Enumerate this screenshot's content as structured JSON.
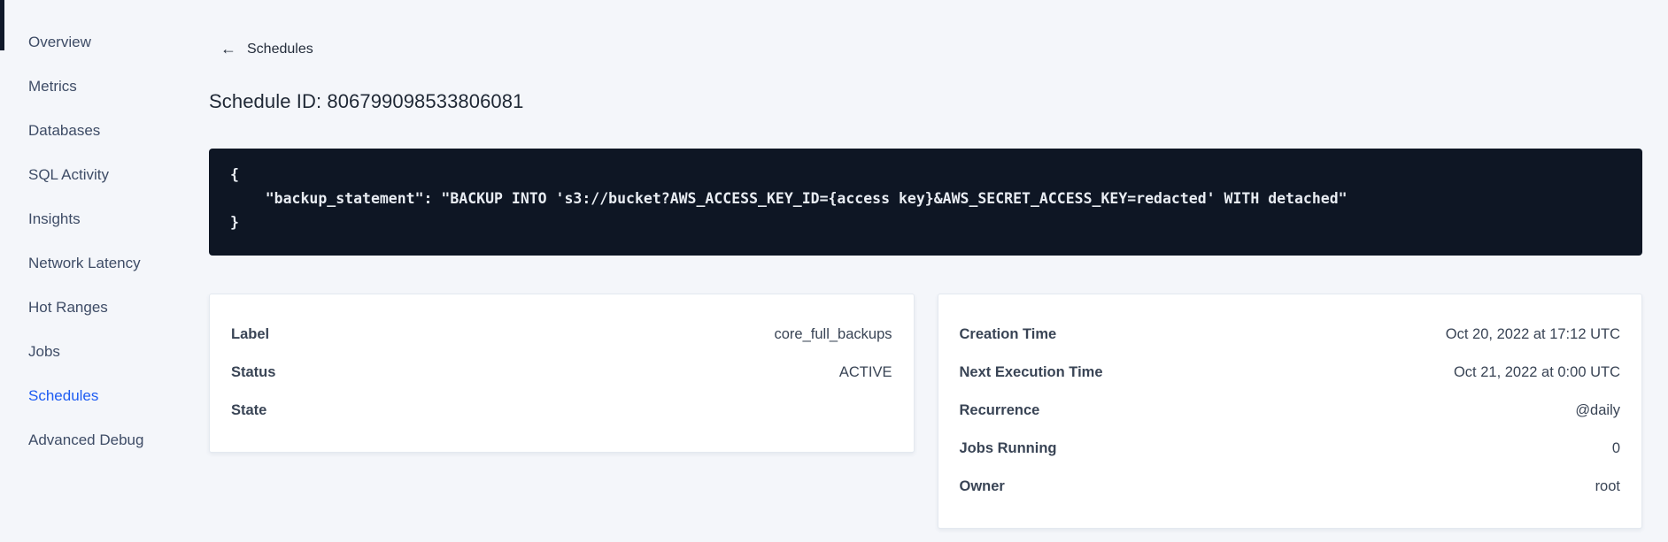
{
  "sidebar": {
    "active_index": 8,
    "items": [
      {
        "label": "Overview"
      },
      {
        "label": "Metrics"
      },
      {
        "label": "Databases"
      },
      {
        "label": "SQL Activity"
      },
      {
        "label": "Insights"
      },
      {
        "label": "Network Latency"
      },
      {
        "label": "Hot Ranges"
      },
      {
        "label": "Jobs"
      },
      {
        "label": "Schedules"
      },
      {
        "label": "Advanced Debug"
      }
    ]
  },
  "header": {
    "back_arrow": "←",
    "back_label": "Schedules",
    "title": "Schedule ID: 806799098533806081"
  },
  "schedule_definition": {
    "lines": [
      "{",
      "    \"backup_statement\": \"BACKUP INTO 's3://bucket?AWS_ACCESS_KEY_ID={access key}&AWS_SECRET_ACCESS_KEY=redacted' WITH detached\"",
      "}"
    ]
  },
  "summary_left": {
    "rows": [
      {
        "label": "Label",
        "value": "core_full_backups"
      },
      {
        "label": "Status",
        "value": "ACTIVE"
      },
      {
        "label": "State",
        "value": ""
      }
    ]
  },
  "summary_right": {
    "rows": [
      {
        "label": "Creation Time",
        "value": "Oct 20, 2022 at 17:12 UTC"
      },
      {
        "label": "Next Execution Time",
        "value": "Oct 21, 2022 at 0:00 UTC"
      },
      {
        "label": "Recurrence",
        "value": "@daily"
      },
      {
        "label": "Jobs Running",
        "value": "0"
      },
      {
        "label": "Owner",
        "value": "root"
      }
    ]
  },
  "colors": {
    "page_bg": "#f4f6fa",
    "accent_blue": "#1d5cf2",
    "code_block_bg": "#0e1624",
    "code_text": "#e8ecf2",
    "text_dark": "#394455",
    "card_bg": "#ffffff"
  }
}
